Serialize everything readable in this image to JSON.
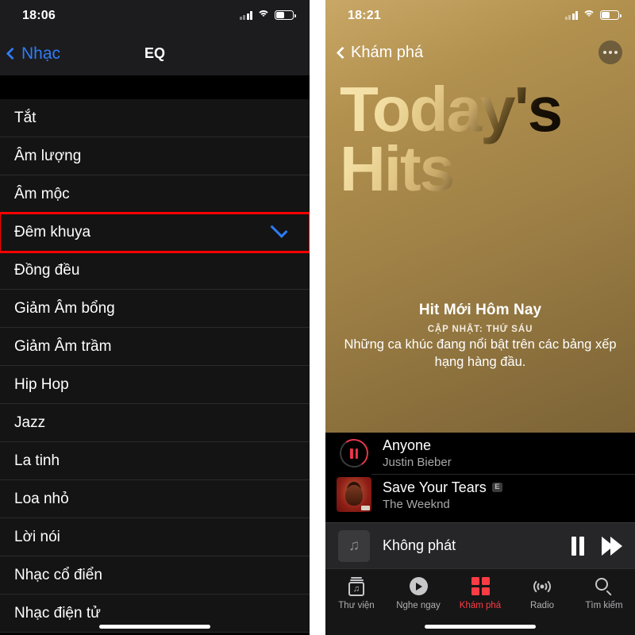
{
  "left_phone": {
    "status_bar": {
      "time": "18:06",
      "signal_icon": "cellular-bars-icon",
      "wifi_icon": "wifi-icon",
      "battery_icon": "battery-icon"
    },
    "nav": {
      "back_label": "Nhạc",
      "title": "EQ",
      "back_icon": "chevron-left-icon"
    },
    "eq_options": [
      {
        "label": "Tắt",
        "selected": false
      },
      {
        "label": "Âm lượng",
        "selected": false
      },
      {
        "label": "Âm mộc",
        "selected": false
      },
      {
        "label": "Đêm khuya",
        "selected": true
      },
      {
        "label": "Đồng đều",
        "selected": false
      },
      {
        "label": "Giảm Âm bổng",
        "selected": false
      },
      {
        "label": "Giảm Âm trầm",
        "selected": false
      },
      {
        "label": "Hip Hop",
        "selected": false
      },
      {
        "label": "Jazz",
        "selected": false
      },
      {
        "label": "La tinh",
        "selected": false
      },
      {
        "label": "Loa nhỏ",
        "selected": false
      },
      {
        "label": "Lời nói",
        "selected": false
      },
      {
        "label": "Nhạc cổ điển",
        "selected": false
      },
      {
        "label": "Nhạc điện tử",
        "selected": false
      }
    ],
    "highlight_color": "#ff0000",
    "accent_color": "#2f7cf6"
  },
  "right_phone": {
    "status_bar": {
      "time": "18:21",
      "signal_icon": "cellular-bars-icon",
      "wifi_icon": "wifi-icon",
      "battery_icon": "battery-icon"
    },
    "nav": {
      "back_label": "Khám phá",
      "back_icon": "chevron-left-icon",
      "more_icon": "more-ellipsis-icon"
    },
    "hero": {
      "artwork_title_line1": "Today's",
      "artwork_title_line2": "Hits",
      "playlist_title": "Hit Mới Hôm Nay",
      "updated": "CẬP NHẬT: THỨ SÁU",
      "description": "Những ca khúc đang nổi bật trên các bảng xếp hạng hàng đầu."
    },
    "songs": [
      {
        "title": "Anyone",
        "artist": "Justin Bieber",
        "explicit": "",
        "art": "now-playing-ring-icon"
      },
      {
        "title": "Save Your Tears",
        "artist": "The Weeknd",
        "explicit": "E",
        "art": "album-artwork"
      }
    ],
    "player": {
      "now_playing": "Không phát",
      "artwork_icon": "music-note-icon",
      "pause_icon": "pause-icon",
      "forward_icon": "fast-forward-icon"
    },
    "tabs": [
      {
        "label": "Thư viện",
        "icon": "library-icon",
        "active": false
      },
      {
        "label": "Nghe ngay",
        "icon": "play-circle-icon",
        "active": false
      },
      {
        "label": "Khám phá",
        "icon": "grid-icon",
        "active": true
      },
      {
        "label": "Radio",
        "icon": "radio-waves-icon",
        "active": false
      },
      {
        "label": "Tìm kiếm",
        "icon": "search-icon",
        "active": false
      }
    ],
    "accent_color": "#fc3c44"
  }
}
